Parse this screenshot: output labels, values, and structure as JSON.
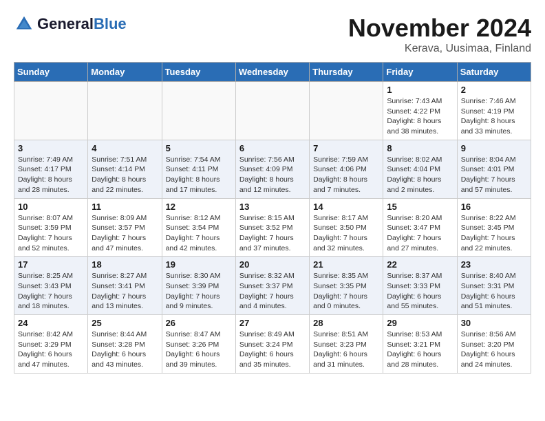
{
  "logo": {
    "general": "General",
    "blue": "Blue"
  },
  "header": {
    "month": "November 2024",
    "location": "Kerava, Uusimaa, Finland"
  },
  "weekdays": [
    "Sunday",
    "Monday",
    "Tuesday",
    "Wednesday",
    "Thursday",
    "Friday",
    "Saturday"
  ],
  "weeks": [
    [
      {
        "day": "",
        "info": ""
      },
      {
        "day": "",
        "info": ""
      },
      {
        "day": "",
        "info": ""
      },
      {
        "day": "",
        "info": ""
      },
      {
        "day": "",
        "info": ""
      },
      {
        "day": "1",
        "info": "Sunrise: 7:43 AM\nSunset: 4:22 PM\nDaylight: 8 hours and 38 minutes."
      },
      {
        "day": "2",
        "info": "Sunrise: 7:46 AM\nSunset: 4:19 PM\nDaylight: 8 hours and 33 minutes."
      }
    ],
    [
      {
        "day": "3",
        "info": "Sunrise: 7:49 AM\nSunset: 4:17 PM\nDaylight: 8 hours and 28 minutes."
      },
      {
        "day": "4",
        "info": "Sunrise: 7:51 AM\nSunset: 4:14 PM\nDaylight: 8 hours and 22 minutes."
      },
      {
        "day": "5",
        "info": "Sunrise: 7:54 AM\nSunset: 4:11 PM\nDaylight: 8 hours and 17 minutes."
      },
      {
        "day": "6",
        "info": "Sunrise: 7:56 AM\nSunset: 4:09 PM\nDaylight: 8 hours and 12 minutes."
      },
      {
        "day": "7",
        "info": "Sunrise: 7:59 AM\nSunset: 4:06 PM\nDaylight: 8 hours and 7 minutes."
      },
      {
        "day": "8",
        "info": "Sunrise: 8:02 AM\nSunset: 4:04 PM\nDaylight: 8 hours and 2 minutes."
      },
      {
        "day": "9",
        "info": "Sunrise: 8:04 AM\nSunset: 4:01 PM\nDaylight: 7 hours and 57 minutes."
      }
    ],
    [
      {
        "day": "10",
        "info": "Sunrise: 8:07 AM\nSunset: 3:59 PM\nDaylight: 7 hours and 52 minutes."
      },
      {
        "day": "11",
        "info": "Sunrise: 8:09 AM\nSunset: 3:57 PM\nDaylight: 7 hours and 47 minutes."
      },
      {
        "day": "12",
        "info": "Sunrise: 8:12 AM\nSunset: 3:54 PM\nDaylight: 7 hours and 42 minutes."
      },
      {
        "day": "13",
        "info": "Sunrise: 8:15 AM\nSunset: 3:52 PM\nDaylight: 7 hours and 37 minutes."
      },
      {
        "day": "14",
        "info": "Sunrise: 8:17 AM\nSunset: 3:50 PM\nDaylight: 7 hours and 32 minutes."
      },
      {
        "day": "15",
        "info": "Sunrise: 8:20 AM\nSunset: 3:47 PM\nDaylight: 7 hours and 27 minutes."
      },
      {
        "day": "16",
        "info": "Sunrise: 8:22 AM\nSunset: 3:45 PM\nDaylight: 7 hours and 22 minutes."
      }
    ],
    [
      {
        "day": "17",
        "info": "Sunrise: 8:25 AM\nSunset: 3:43 PM\nDaylight: 7 hours and 18 minutes."
      },
      {
        "day": "18",
        "info": "Sunrise: 8:27 AM\nSunset: 3:41 PM\nDaylight: 7 hours and 13 minutes."
      },
      {
        "day": "19",
        "info": "Sunrise: 8:30 AM\nSunset: 3:39 PM\nDaylight: 7 hours and 9 minutes."
      },
      {
        "day": "20",
        "info": "Sunrise: 8:32 AM\nSunset: 3:37 PM\nDaylight: 7 hours and 4 minutes."
      },
      {
        "day": "21",
        "info": "Sunrise: 8:35 AM\nSunset: 3:35 PM\nDaylight: 7 hours and 0 minutes."
      },
      {
        "day": "22",
        "info": "Sunrise: 8:37 AM\nSunset: 3:33 PM\nDaylight: 6 hours and 55 minutes."
      },
      {
        "day": "23",
        "info": "Sunrise: 8:40 AM\nSunset: 3:31 PM\nDaylight: 6 hours and 51 minutes."
      }
    ],
    [
      {
        "day": "24",
        "info": "Sunrise: 8:42 AM\nSunset: 3:29 PM\nDaylight: 6 hours and 47 minutes."
      },
      {
        "day": "25",
        "info": "Sunrise: 8:44 AM\nSunset: 3:28 PM\nDaylight: 6 hours and 43 minutes."
      },
      {
        "day": "26",
        "info": "Sunrise: 8:47 AM\nSunset: 3:26 PM\nDaylight: 6 hours and 39 minutes."
      },
      {
        "day": "27",
        "info": "Sunrise: 8:49 AM\nSunset: 3:24 PM\nDaylight: 6 hours and 35 minutes."
      },
      {
        "day": "28",
        "info": "Sunrise: 8:51 AM\nSunset: 3:23 PM\nDaylight: 6 hours and 31 minutes."
      },
      {
        "day": "29",
        "info": "Sunrise: 8:53 AM\nSunset: 3:21 PM\nDaylight: 6 hours and 28 minutes."
      },
      {
        "day": "30",
        "info": "Sunrise: 8:56 AM\nSunset: 3:20 PM\nDaylight: 6 hours and 24 minutes."
      }
    ]
  ]
}
